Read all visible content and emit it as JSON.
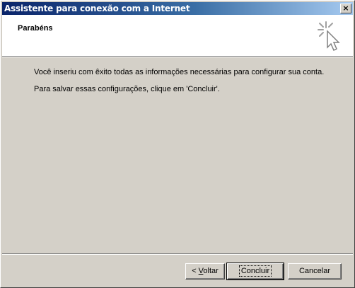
{
  "window": {
    "title": "Assistente para conexão com a Internet",
    "close_label": "×"
  },
  "header": {
    "title": "Parabéns",
    "icon": "wizard-sparkle-cursor-icon"
  },
  "body": {
    "line1": "Você inseriu com êxito todas as informações necessárias para configurar sua conta.",
    "line2": "Para salvar essas configurações, clique em 'Concluir'."
  },
  "buttons": {
    "back_prefix": "< ",
    "back_accel": "V",
    "back_rest": "oltar",
    "finish": "Concluir",
    "cancel": "Cancelar"
  },
  "colors": {
    "titlebar_start": "#0a246a",
    "titlebar_end": "#a6caf0",
    "face": "#d4d0c8"
  }
}
